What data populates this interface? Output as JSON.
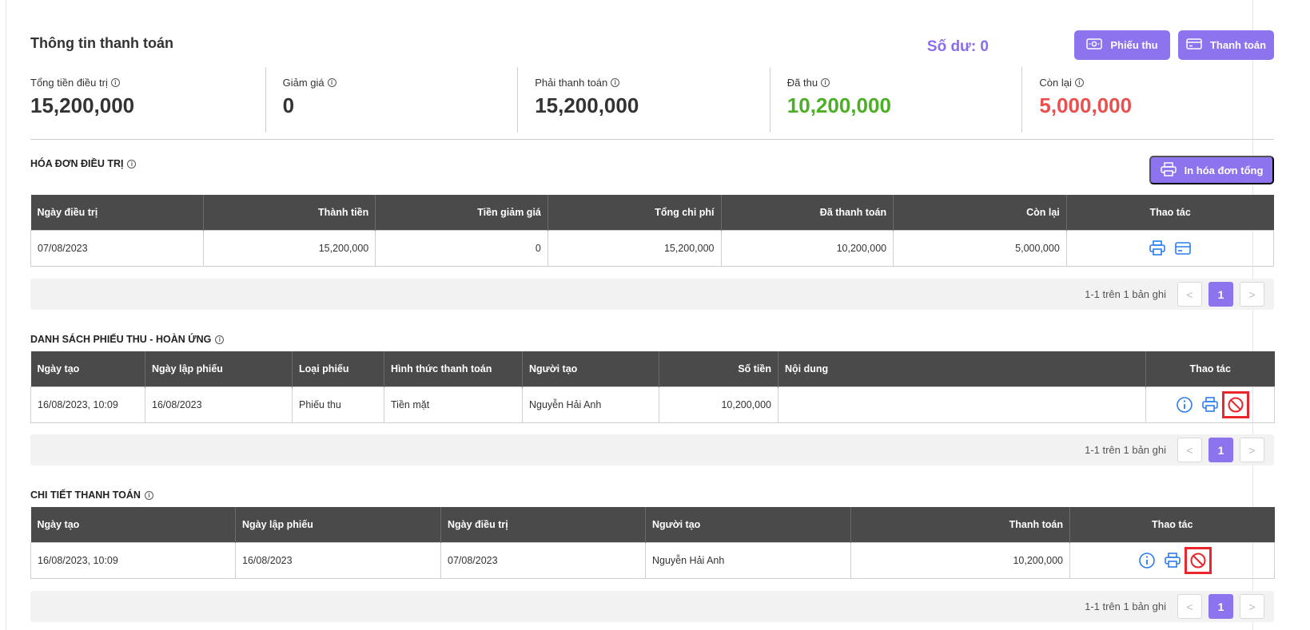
{
  "header": {
    "title": "Thông tin thanh toán",
    "balance": "Số dư: 0",
    "receipt_btn": "Phiếu thu",
    "pay_btn": "Thanh toán"
  },
  "stats": [
    {
      "label": "Tổng tiền điều trị",
      "value": "15,200,000"
    },
    {
      "label": "Giảm giá",
      "value": "0"
    },
    {
      "label": "Phải thanh toán",
      "value": "15,200,000"
    },
    {
      "label": "Đã thu",
      "value": "10,200,000"
    },
    {
      "label": "Còn lại",
      "value": "5,000,000"
    }
  ],
  "invoices": {
    "title": "HÓA ĐƠN ĐIỀU TRỊ",
    "print_btn": "In hóa đơn tổng",
    "columns": [
      "Ngày điều trị",
      "Thành tiền",
      "Tiền giảm giá",
      "Tổng chi phí",
      "Đã thanh toán",
      "Còn lại",
      "Thao tác"
    ],
    "rows": [
      {
        "date": "07/08/2023",
        "amount": "15,200,000",
        "discount": "0",
        "total": "15,200,000",
        "paid": "10,200,000",
        "remaining": "5,000,000"
      }
    ],
    "pager": {
      "info": "1-1 trên 1 bản ghi",
      "page": "1",
      "prev": "<",
      "next": ">"
    }
  },
  "receipts": {
    "title": "DANH SÁCH PHIẾU THU - HOÀN ỨNG",
    "columns": [
      "Ngày tạo",
      "Ngày lập phiếu",
      "Loại phiếu",
      "Hình thức thanh toán",
      "Người tạo",
      "Số tiền",
      "Nội dung",
      "Thao tác"
    ],
    "rows": [
      {
        "created": "16/08/2023, 10:09",
        "issued": "16/08/2023",
        "type": "Phiếu thu",
        "method": "Tiền mặt",
        "creator": "Nguyễn Hải Anh",
        "amount": "10,200,000",
        "note": ""
      }
    ],
    "pager": {
      "info": "1-1 trên 1 bản ghi",
      "page": "1",
      "prev": "<",
      "next": ">"
    }
  },
  "payments": {
    "title": "CHI TIẾT THANH TOÁN",
    "columns": [
      "Ngày tạo",
      "Ngày lập phiếu",
      "Ngày điều trị",
      "Người tạo",
      "Thanh toán",
      "Thao tác"
    ],
    "rows": [
      {
        "created": "16/08/2023, 10:09",
        "issued": "16/08/2023",
        "treat_date": "07/08/2023",
        "creator": "Nguyễn Hải Anh",
        "amount": "10,200,000"
      }
    ],
    "pager": {
      "info": "1-1 trên 1 bản ghi",
      "page": "1",
      "prev": "<",
      "next": ">"
    }
  },
  "colors": {
    "accent": "#8d73ee",
    "paid": "#4caf26",
    "remaining": "#e95050",
    "icon": "#2b7de9",
    "cancel": "#e8262c"
  }
}
